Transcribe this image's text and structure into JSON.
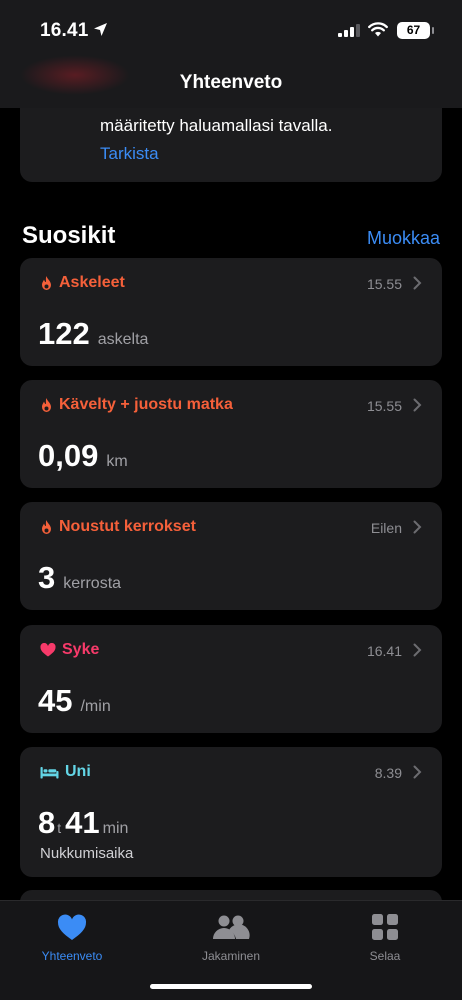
{
  "status": {
    "time": "16.41",
    "battery": "67"
  },
  "nav": {
    "title": "Yhteenveto"
  },
  "info": {
    "text": "määritetty haluamallasi tavalla.",
    "link": "Tarkista"
  },
  "favorites": {
    "title": "Suosikit",
    "edit": "Muokkaa"
  },
  "cards": [
    {
      "label": "Askeleet",
      "time": "15.55",
      "value": "122",
      "unit": "askelta",
      "color": "#f5603a",
      "icon": "flame-icon"
    },
    {
      "label": "Kävelty + juostu matka",
      "time": "15.55",
      "value": "0,09",
      "unit": "km",
      "color": "#f5603a",
      "icon": "flame-icon"
    },
    {
      "label": "Noustut kerrokset",
      "time": "Eilen",
      "value": "3",
      "unit": "kerrosta",
      "color": "#f5603a",
      "icon": "flame-icon"
    },
    {
      "label": "Syke",
      "time": "16.41",
      "value": "45",
      "unit": "/min",
      "color": "#f73a6a",
      "icon": "heart-icon"
    }
  ],
  "sleep": {
    "label": "Uni",
    "time": "8.39",
    "hours": "8",
    "hours_unit": "t",
    "minutes": "41",
    "minutes_unit": "min",
    "sub": "Nukkumisaika",
    "color": "#63d5e6",
    "icon": "bed-icon"
  },
  "tabs": [
    {
      "label": "Yhteenveto",
      "icon": "heart-icon",
      "active": true
    },
    {
      "label": "Jakaminen",
      "icon": "people-icon",
      "active": false
    },
    {
      "label": "Selaa",
      "icon": "grid-icon",
      "active": false
    }
  ]
}
